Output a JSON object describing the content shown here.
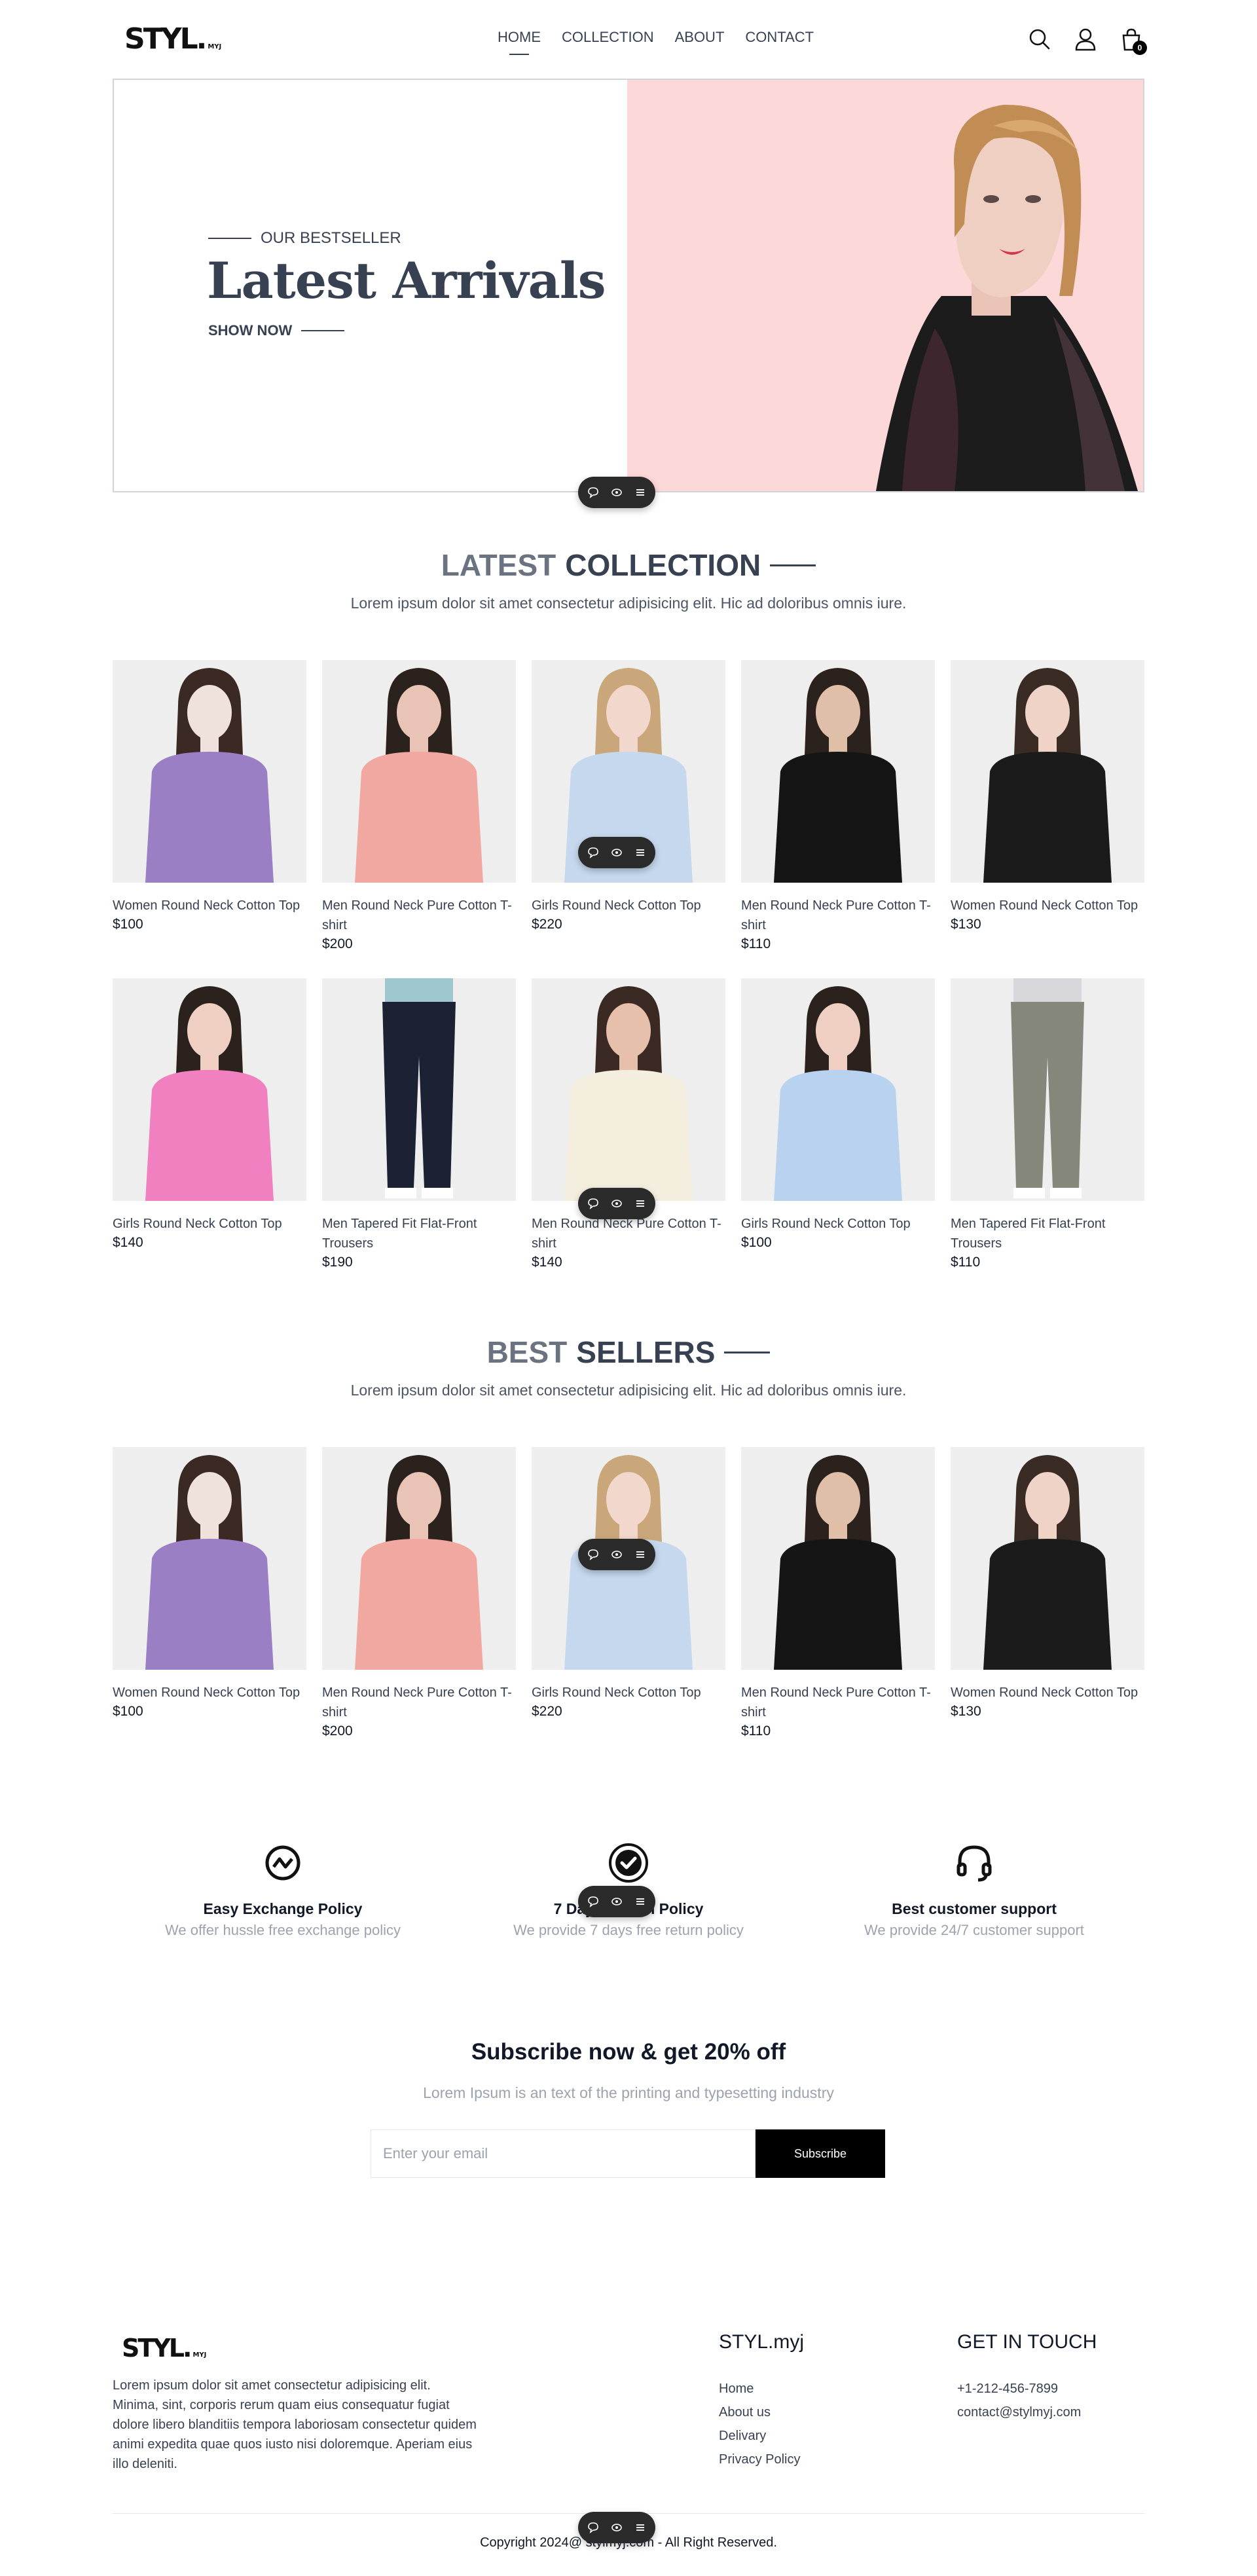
{
  "brand": {
    "logo": "STYL.",
    "logo_sub": "MYJ",
    "footer_name": "STYL.myj"
  },
  "nav": {
    "links": [
      "HOME",
      "COLLECTION",
      "ABOUT",
      "CONTACT"
    ],
    "icons": [
      "search-icon",
      "user-icon",
      "cart-icon"
    ],
    "cart_count": "0"
  },
  "hero": {
    "kicker": "OUR BESTSELLER",
    "title": "Latest Arrivals",
    "cta": "SHOW NOW",
    "bg_color": "#fdd8d8"
  },
  "latest": {
    "title_light": "LATEST",
    "title_bold": "COLLECTION",
    "subtitle": "Lorem ipsum dolor sit amet consectetur adipisicing elit. Hic ad doloribus omnis iure.",
    "products": [
      {
        "name": "Women Round Neck Cotton Top",
        "price": "$100"
      },
      {
        "name": "Men Round Neck Pure Cotton T-shirt",
        "price": "$200"
      },
      {
        "name": "Girls Round Neck Cotton Top",
        "price": "$220"
      },
      {
        "name": "Men Round Neck Pure Cotton T-shirt",
        "price": "$110"
      },
      {
        "name": "Women Round Neck Cotton Top",
        "price": "$130"
      },
      {
        "name": "Girls Round Neck Cotton Top",
        "price": "$140"
      },
      {
        "name": "Men Tapered Fit Flat-Front Trousers",
        "price": "$190"
      },
      {
        "name": "Men Round Neck Pure Cotton T-shirt",
        "price": "$140"
      },
      {
        "name": "Girls Round Neck Cotton Top",
        "price": "$100"
      },
      {
        "name": "Men Tapered Fit Flat-Front Trousers",
        "price": "$110"
      }
    ]
  },
  "best": {
    "title_light": "BEST",
    "title_bold": "SELLERS",
    "subtitle": "Lorem ipsum dolor sit amet consectetur adipisicing elit. Hic ad doloribus omnis iure.",
    "products": [
      {
        "name": "Women Round Neck Cotton Top",
        "price": "$100"
      },
      {
        "name": "Men Round Neck Pure Cotton T-shirt",
        "price": "$200"
      },
      {
        "name": "Girls Round Neck Cotton Top",
        "price": "$220"
      },
      {
        "name": "Men Round Neck Pure Cotton T-shirt",
        "price": "$110"
      },
      {
        "name": "Women Round Neck Cotton Top",
        "price": "$130"
      }
    ]
  },
  "features": [
    {
      "icon": "exchange-icon",
      "title": "Easy Exchange Policy",
      "desc": "We offer hussle free exchange policy"
    },
    {
      "icon": "badge-check-icon",
      "title": "7 Days Return Policy",
      "desc": "We provide 7 days free return policy"
    },
    {
      "icon": "headset-icon",
      "title": "Best customer support",
      "desc": "We provide 24/7 customer support"
    }
  ],
  "subscribe": {
    "title": "Subscribe now & get 20% off",
    "desc": "Lorem Ipsum is an text of the printing and typesetting industry",
    "placeholder": "Enter your email",
    "button": "Subscribe"
  },
  "footer": {
    "about": "Lorem ipsum dolor sit amet consectetur adipisicing elit. Minima, sint, corporis rerum quam eius consequatur fugiat dolore libero blanditiis tempora laboriosam consectetur quidem animi expedita quae quos iusto nisi doloremque. Aperiam eius illo deleniti.",
    "links": [
      "Home",
      "About us",
      "Delivary",
      "Privacy Policy"
    ],
    "contact_title": "GET IN TOUCH",
    "contact": [
      "+1-212-456-7899",
      "contact@stylmyj.com"
    ],
    "copyright": "Copyright 2024@ stylmyj.com - All Right Reserved."
  }
}
